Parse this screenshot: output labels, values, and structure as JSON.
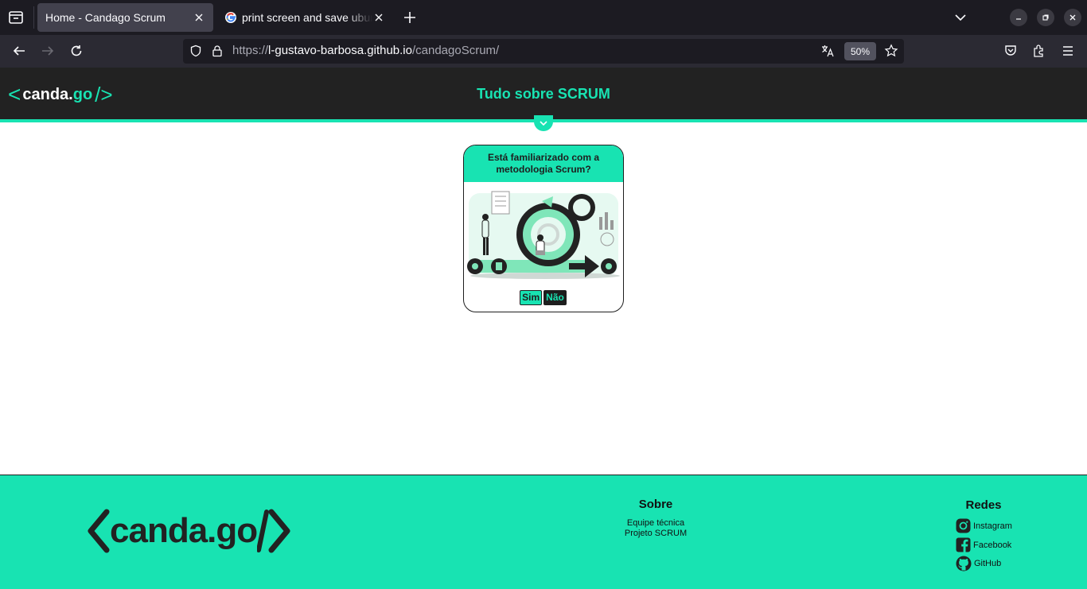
{
  "browser": {
    "tabs": [
      {
        "title": "Home - Candago Scrum",
        "active": true
      },
      {
        "title": "print screen and save ubuntu",
        "active": false
      }
    ],
    "url": {
      "scheme": "https://",
      "host": "l-gustavo-barbosa.github.io",
      "path": "/candagoScrum/"
    },
    "zoom": "50%"
  },
  "header": {
    "logo": {
      "open": "<",
      "text": "canda",
      "dot": ".",
      "go": "go",
      "close": "/>"
    },
    "title": "Tudo sobre SCRUM"
  },
  "card": {
    "question": "Está familiarizado com a metodologia Scrum?",
    "yes": "Sim",
    "no": "Não"
  },
  "footer": {
    "logo": {
      "open": "<",
      "text": "canda",
      "dot": ".",
      "go": "go",
      "close": "/>"
    },
    "about": {
      "title": "Sobre",
      "links": [
        "Equipe técnica",
        "Projeto SCRUM"
      ]
    },
    "social": {
      "title": "Redes",
      "links": [
        "Instagram",
        "Facebook",
        "GitHub"
      ]
    }
  },
  "colors": {
    "accent": "#18e3b2",
    "dark": "#222222"
  }
}
